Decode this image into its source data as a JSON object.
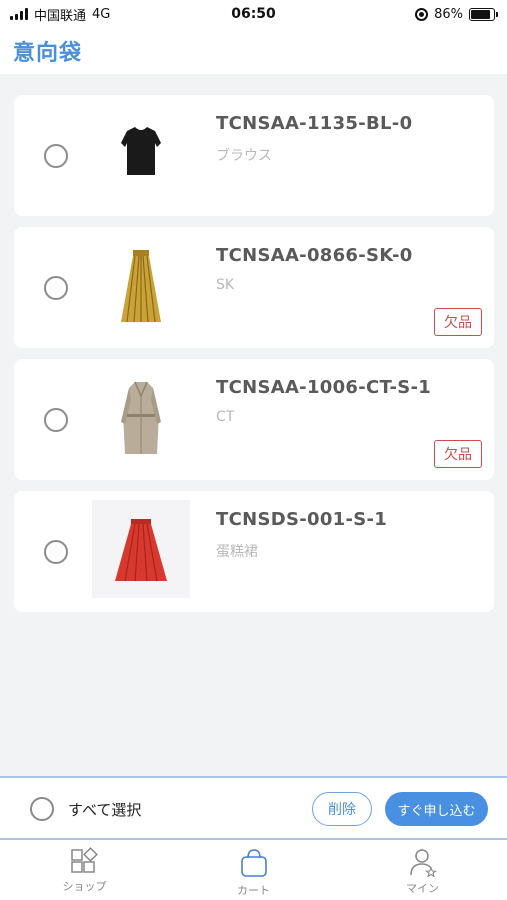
{
  "status_bar": {
    "carrier": "中国联通",
    "network": "4G",
    "time": "06:50",
    "battery": "86%",
    "battery_level": 0.86
  },
  "header": {
    "title": "意向袋"
  },
  "items": [
    {
      "code": "TCNSAA-1135-BL-0",
      "category": "ブラウス",
      "badge": "",
      "thumb_icon": "black-blouse-icon"
    },
    {
      "code": "TCNSAA-0866-SK-0",
      "category": "SK",
      "badge": "欠品",
      "thumb_icon": "gold-pleated-skirt-icon"
    },
    {
      "code": "TCNSAA-1006-CT-S-1",
      "category": "CT",
      "badge": "欠品",
      "thumb_icon": "trench-coat-icon"
    },
    {
      "code": "TCNSDS-001-S-1",
      "category": "蛋糕裙",
      "badge": "",
      "thumb_icon": "red-skirt-icon"
    }
  ],
  "action_bar": {
    "select_all_label": "すべて選択",
    "delete_label": "削除",
    "apply_label": "すぐ申し込む"
  },
  "tabs": [
    {
      "label": "ショップ",
      "icon": "shop-grid-icon",
      "active": false
    },
    {
      "label": "カート",
      "icon": "cart-bag-icon",
      "active": true
    },
    {
      "label": "マイン",
      "icon": "user-star-icon",
      "active": false
    }
  ],
  "colors": {
    "accent": "#4a90d9",
    "badge": "#c94b4b",
    "background": "#f2f3f5"
  }
}
